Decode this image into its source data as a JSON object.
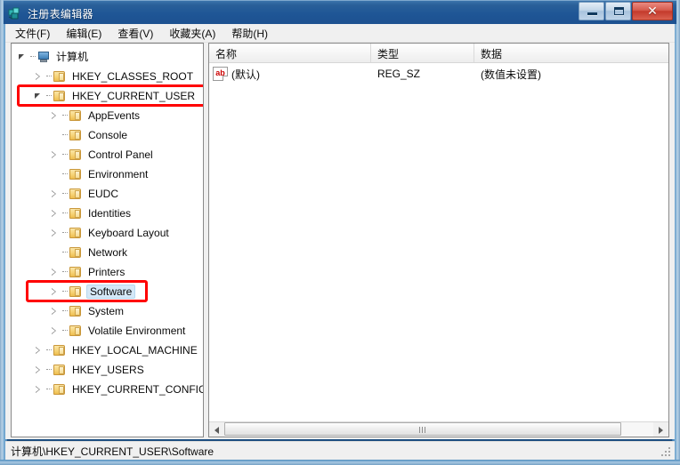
{
  "window": {
    "title": "注册表编辑器",
    "app_icon": "registry-editor-icon",
    "buttons": {
      "minimize": "最小化",
      "maximize": "最大化",
      "close": "✕"
    }
  },
  "menubar": {
    "items": [
      {
        "label": "文件(F)"
      },
      {
        "label": "编辑(E)"
      },
      {
        "label": "查看(V)"
      },
      {
        "label": "收藏夹(A)"
      },
      {
        "label": "帮助(H)"
      }
    ]
  },
  "tree": {
    "items": [
      {
        "label": "计算机",
        "indent": 0,
        "icon": "computer-icon",
        "expander": "expanded",
        "selected": false
      },
      {
        "label": "HKEY_CLASSES_ROOT",
        "indent": 1,
        "icon": "folder-icon",
        "expander": "collapsed",
        "selected": false
      },
      {
        "label": "HKEY_CURRENT_USER",
        "indent": 1,
        "icon": "folder-icon",
        "expander": "expanded",
        "selected": false
      },
      {
        "label": "AppEvents",
        "indent": 2,
        "icon": "folder-icon",
        "expander": "collapsed",
        "selected": false
      },
      {
        "label": "Console",
        "indent": 2,
        "icon": "folder-icon",
        "expander": "none",
        "selected": false
      },
      {
        "label": "Control Panel",
        "indent": 2,
        "icon": "folder-icon",
        "expander": "collapsed",
        "selected": false
      },
      {
        "label": "Environment",
        "indent": 2,
        "icon": "folder-icon",
        "expander": "none",
        "selected": false
      },
      {
        "label": "EUDC",
        "indent": 2,
        "icon": "folder-icon",
        "expander": "collapsed",
        "selected": false
      },
      {
        "label": "Identities",
        "indent": 2,
        "icon": "folder-icon",
        "expander": "collapsed",
        "selected": false
      },
      {
        "label": "Keyboard Layout",
        "indent": 2,
        "icon": "folder-icon",
        "expander": "collapsed",
        "selected": false
      },
      {
        "label": "Network",
        "indent": 2,
        "icon": "folder-icon",
        "expander": "none",
        "selected": false
      },
      {
        "label": "Printers",
        "indent": 2,
        "icon": "folder-icon",
        "expander": "collapsed",
        "selected": false
      },
      {
        "label": "Software",
        "indent": 2,
        "icon": "folder-icon",
        "expander": "collapsed",
        "selected": true
      },
      {
        "label": "System",
        "indent": 2,
        "icon": "folder-icon",
        "expander": "collapsed",
        "selected": false
      },
      {
        "label": "Volatile Environment",
        "indent": 2,
        "icon": "folder-icon",
        "expander": "collapsed",
        "selected": false
      },
      {
        "label": "HKEY_LOCAL_MACHINE",
        "indent": 1,
        "icon": "folder-icon",
        "expander": "collapsed",
        "selected": false
      },
      {
        "label": "HKEY_USERS",
        "indent": 1,
        "icon": "folder-icon",
        "expander": "collapsed",
        "selected": false
      },
      {
        "label": "HKEY_CURRENT_CONFIG",
        "indent": 1,
        "icon": "folder-icon",
        "expander": "collapsed",
        "selected": false
      }
    ]
  },
  "annotations": {
    "color": "#ff0000",
    "boxes": [
      {
        "target": "HKEY_CURRENT_USER",
        "name": "highlight-hkey-current-user"
      },
      {
        "target": "Software",
        "name": "highlight-software"
      }
    ]
  },
  "list": {
    "columns": [
      {
        "label": "名称"
      },
      {
        "label": "类型"
      },
      {
        "label": "数据"
      }
    ],
    "rows": [
      {
        "name": "(默认)",
        "type": "REG_SZ",
        "data": "(数值未设置)",
        "icon": "string-value-icon"
      }
    ]
  },
  "statusbar": {
    "path": "计算机\\HKEY_CURRENT_USER\\Software"
  }
}
